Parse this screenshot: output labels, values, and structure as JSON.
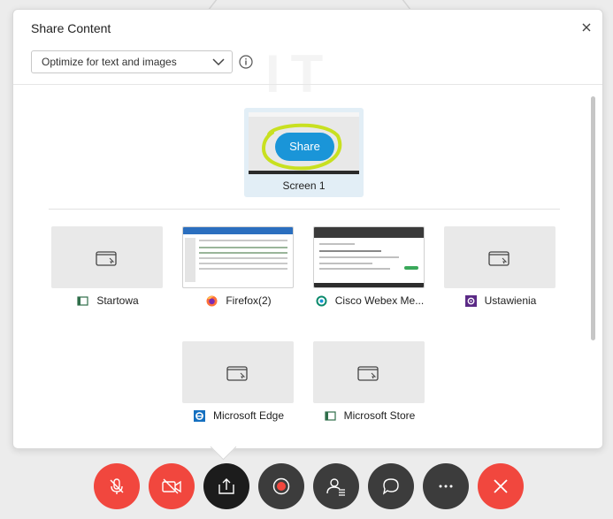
{
  "dialog": {
    "title": "Share Content",
    "optimize_select": {
      "value": "Optimize for text and images"
    }
  },
  "screen": {
    "label": "Screen 1",
    "share_button_label": "Share"
  },
  "applications": [
    {
      "label": "Startowa",
      "icon": "window-app-icon",
      "thumbnail": "placeholder"
    },
    {
      "label": "Firefox(2)",
      "icon": "firefox-icon",
      "thumbnail": "preview"
    },
    {
      "label": "Cisco Webex Me...",
      "icon": "webex-icon",
      "thumbnail": "preview"
    },
    {
      "label": "Ustawienia",
      "icon": "settings-gear-icon",
      "thumbnail": "placeholder"
    },
    {
      "label": "Microsoft Edge",
      "icon": "edge-icon",
      "thumbnail": "placeholder"
    },
    {
      "label": "Microsoft Store",
      "icon": "store-icon",
      "thumbnail": "placeholder"
    }
  ],
  "toolbar": [
    {
      "name": "mute-button",
      "icon": "microphone-off-icon",
      "color": "#f1473e"
    },
    {
      "name": "stop-video-button",
      "icon": "video-off-icon",
      "color": "#f1473e"
    },
    {
      "name": "share-button",
      "icon": "share-icon",
      "color": "#1c1c1c"
    },
    {
      "name": "record-button",
      "icon": "record-icon",
      "color": "#3c3c3c"
    },
    {
      "name": "participants-button",
      "icon": "participants-icon",
      "color": "#3c3c3c"
    },
    {
      "name": "chat-button",
      "icon": "chat-icon",
      "color": "#3c3c3c"
    },
    {
      "name": "more-options-button",
      "icon": "more-icon",
      "color": "#3c3c3c"
    },
    {
      "name": "leave-button",
      "icon": "close-icon",
      "color": "#f1473e"
    }
  ],
  "colors": {
    "accent": "#1a95d8",
    "danger": "#f1473e",
    "highlight_annotation": "#c8e020"
  }
}
